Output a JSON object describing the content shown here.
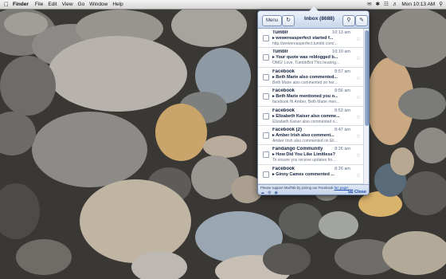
{
  "menubar": {
    "app_name": "Finder",
    "items": [
      "File",
      "Edit",
      "View",
      "Go",
      "Window",
      "Help"
    ],
    "clock": "Mon 10:13 AM"
  },
  "popup": {
    "menu_label": "Menu",
    "inbox_title": "Inbox (8688)",
    "messages": [
      {
        "sender": "Tumblr",
        "time": "10:13 am",
        "subject": "▸ wewereasperfect started f...",
        "snippet": "http://wewereasperfect.tumblr.com/..."
      },
      {
        "sender": "Tumblr",
        "time": "10:10 am",
        "subject": "▸ Your quote was reblogged b...",
        "snippet": "OMG! Love, TumblrBot This hearing..."
      },
      {
        "sender": "Facebook",
        "time": "8:57 am",
        "subject": "▸ Beth Marie also commented...",
        "snippet": "Beth Marie also commented on her..."
      },
      {
        "sender": "Facebook",
        "time": "8:56 am",
        "subject": "▸ Beth Marie mentioned you o...",
        "snippet": "facebook Hi Amber, Beth Marie men..."
      },
      {
        "sender": "Facebook",
        "time": "8:53 am",
        "subject": "▸ Elizabeth Kaiser also comme...",
        "snippet": "Elizabeth Kaiser also commented o..."
      },
      {
        "sender": "Facebook (2)",
        "time": "8:47 am",
        "subject": "▸ Amber Irish also comment...",
        "snippet": "Amber Irish also commented on Eli..."
      },
      {
        "sender": "Fandango Community",
        "time": "8:26 am",
        "subject": "▸ How Did You Like Limitless?",
        "snippet": "To ensure you receive updates fro..."
      },
      {
        "sender": "Facebook",
        "time": "8:26 am",
        "subject": "▸ Ginny Cames commented ...",
        "snippet": ""
      }
    ],
    "support_text": "Please support MailTab by joining our Facebook",
    "support_link": "fan page!",
    "close_label": "Close"
  },
  "colors": {
    "accent": "#1d4da8",
    "toolbar": "#c7d5ea"
  },
  "icons": {
    "apple": "apple-icon",
    "refresh": "refresh-icon",
    "search": "search-icon",
    "compose": "compose-icon",
    "star": "star-icon"
  }
}
